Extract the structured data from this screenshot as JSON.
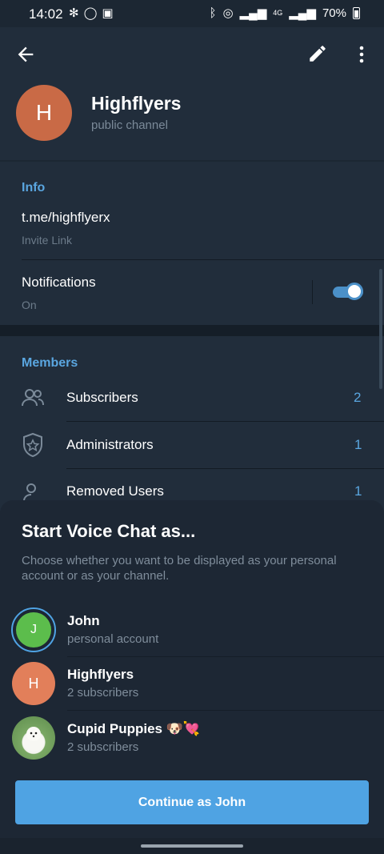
{
  "status_bar": {
    "time": "14:02",
    "battery": "70%",
    "network": "4G"
  },
  "header": {
    "avatar_letter": "H",
    "avatar_color": "#c96a46",
    "title": "Highflyers",
    "subtitle": "public channel"
  },
  "info": {
    "title": "Info",
    "link": "t.me/highflyerx",
    "link_label": "Invite Link",
    "notifications_label": "Notifications",
    "notifications_value": "On"
  },
  "members": {
    "title": "Members",
    "items": [
      {
        "label": "Subscribers",
        "count": "2",
        "icon": "people-icon"
      },
      {
        "label": "Administrators",
        "count": "1",
        "icon": "shield-star-icon"
      },
      {
        "label": "Removed Users",
        "count": "1",
        "icon": "person-remove-icon"
      }
    ]
  },
  "sheet": {
    "title": "Start Voice Chat as...",
    "description": "Choose whether you want to be displayed as your personal account or as your channel.",
    "accounts": [
      {
        "name": "John",
        "sub": "personal account",
        "letter": "J",
        "color": "#5cbd4c",
        "selected": true
      },
      {
        "name": "Highflyers",
        "sub": "2 subscribers",
        "letter": "H",
        "color": "#e27f5a"
      },
      {
        "name": "Cupid Puppies 🐶💘",
        "sub": "2 subscribers",
        "letter": "",
        "color": "#7aa864"
      }
    ],
    "continue_label": "Continue as John"
  },
  "colors": {
    "accent": "#5aa6e0",
    "button": "#4fa3e3",
    "background": "#1c2733"
  }
}
